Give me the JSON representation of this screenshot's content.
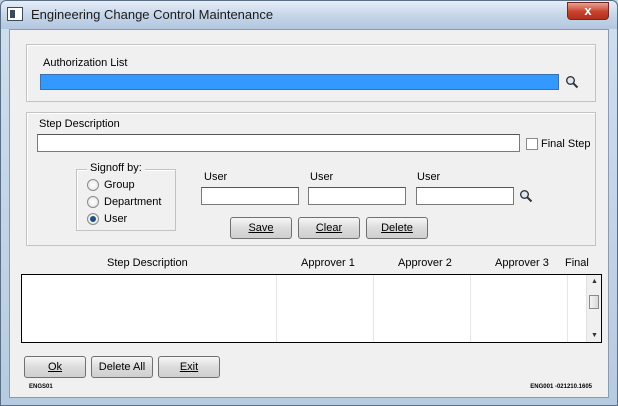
{
  "window": {
    "title": "Engineering Change Control Maintenance",
    "close_glyph": "x"
  },
  "authorization": {
    "label": "Authorization List",
    "value": ""
  },
  "step": {
    "label": "Step Description",
    "value": "",
    "final_step_label": "Final Step",
    "final_step_checked": false
  },
  "signoff": {
    "label": "Signoff by:",
    "options": [
      "Group",
      "Department",
      "User"
    ],
    "selected": "User"
  },
  "users": {
    "labels": [
      "User",
      "User",
      "User"
    ],
    "values": [
      "",
      "",
      ""
    ]
  },
  "step_buttons": {
    "save": "Save",
    "clear": "Clear",
    "delete": "Delete"
  },
  "table": {
    "columns": [
      "Step Description",
      "Approver 1",
      "Approver 2",
      "Approver 3",
      "Final"
    ],
    "rows": []
  },
  "bottom_buttons": {
    "ok": "Ok",
    "delete_all": "Delete All",
    "exit": "Exit"
  },
  "footer": {
    "left_code": "ENGS01",
    "right_code": "ENG001 -021210.1605"
  }
}
